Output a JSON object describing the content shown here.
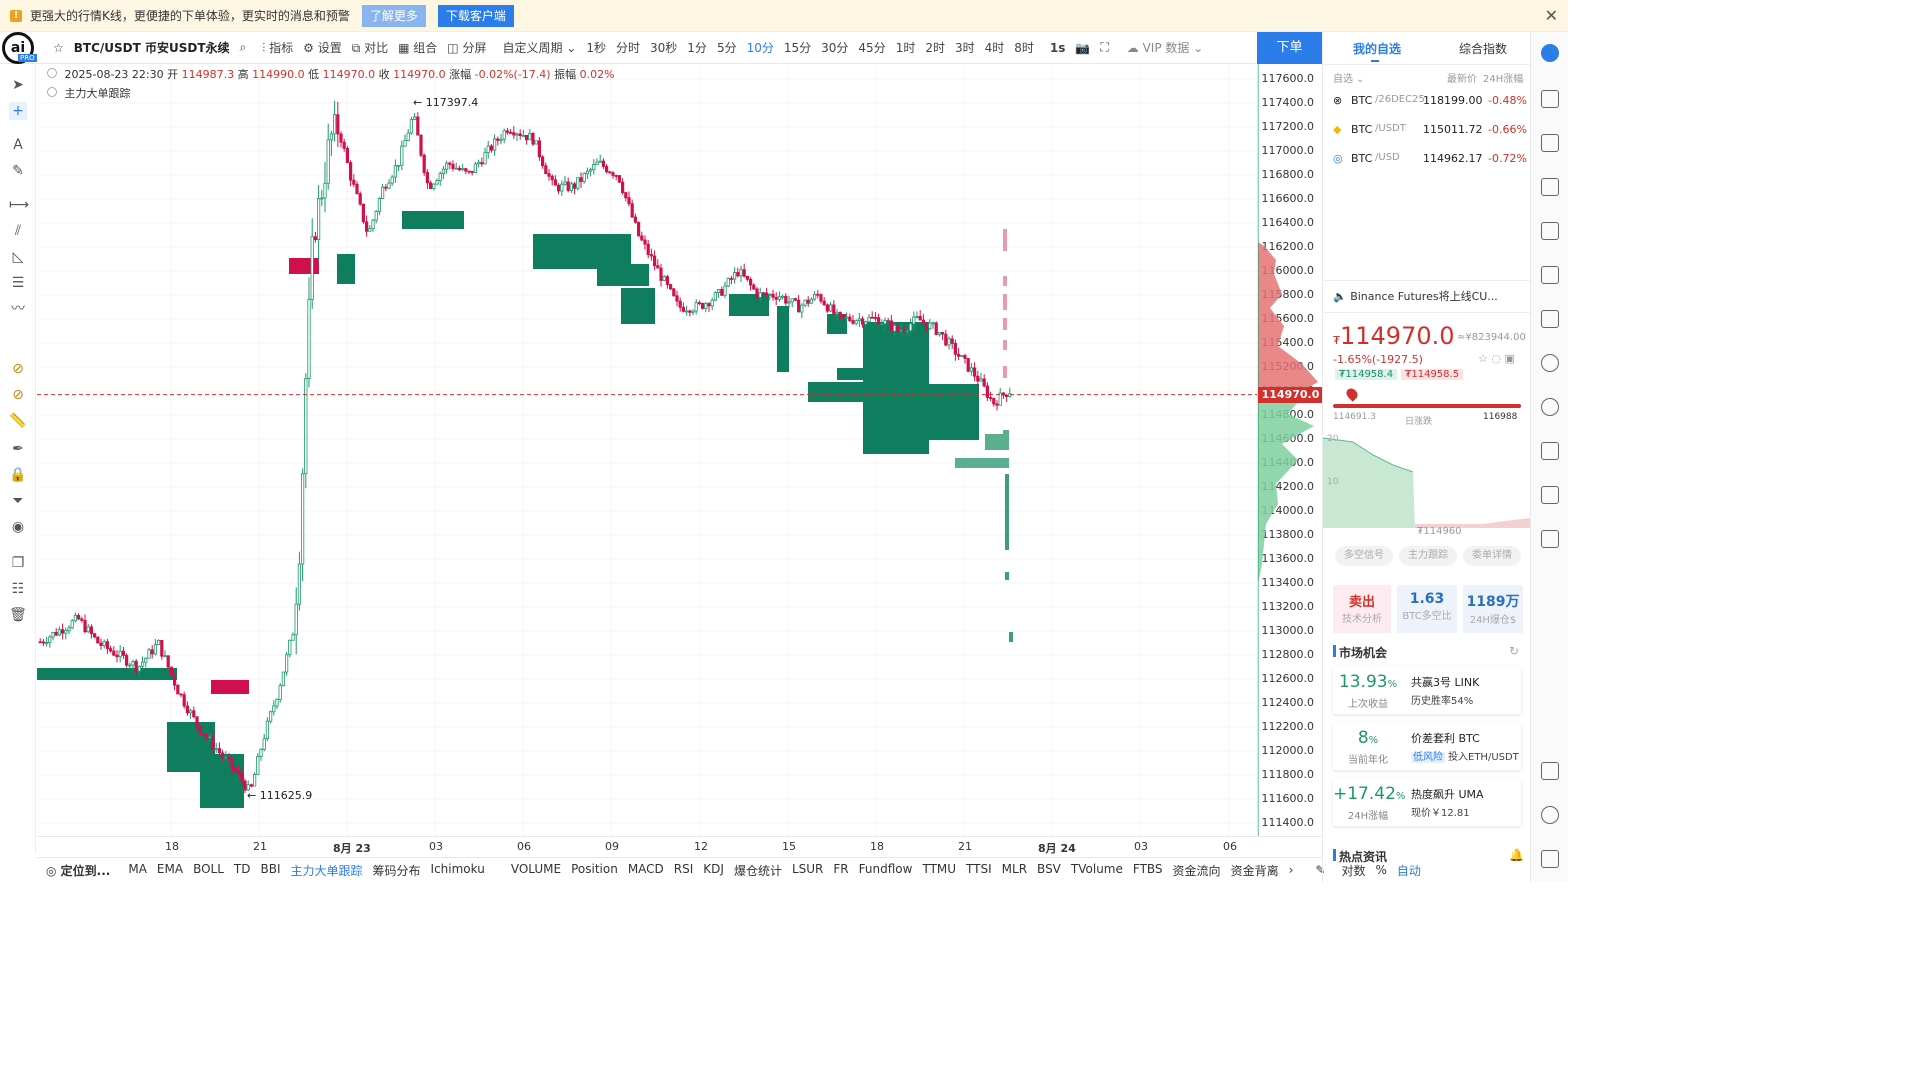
{
  "banner": {
    "message": "更强大的行情K线，更便捷的下单体验，更实时的消息和预警",
    "learn_more": "了解更多",
    "download": "下载客户端",
    "close": "✕",
    "colors": {
      "learn_more_bg": "#8ab4ee",
      "download_bg": "#2b7de9"
    }
  },
  "toolbar": {
    "symbol": "BTC/USDT 币安USDT永续",
    "indicators": "指标",
    "settings": "设置",
    "compare": "对比",
    "combine": "组合",
    "split": "分屏",
    "custom_period": "自定义周期",
    "periods": [
      "1秒",
      "分时",
      "30秒",
      "1分",
      "5分",
      "10分",
      "15分",
      "30分",
      "45分",
      "1时",
      "2时",
      "3时",
      "4时",
      "8时"
    ],
    "active_period": "10分",
    "interval_1s": "1s",
    "vip": "VIP 数据",
    "order": "下单"
  },
  "infobar": {
    "datetime": "2025-08-23 22:30",
    "open_label": "开",
    "open": "114987.3",
    "high_label": "高",
    "high": "114990.0",
    "low_label": "低",
    "low": "114970.0",
    "close_label": "收",
    "close": "114970.0",
    "change_label": "涨幅",
    "change": "-0.02%(-17.4)",
    "amp_label": "振幅",
    "amp": "0.02%",
    "indicator": "主力大单跟踪"
  },
  "chart_data": {
    "type": "candlestick",
    "y_ticks": [
      "117600.0",
      "117400.0",
      "117200.0",
      "117000.0",
      "116800.0",
      "116600.0",
      "116400.0",
      "116200.0",
      "116000.0",
      "115800.0",
      "115600.0",
      "115400.0",
      "115200.0",
      "115000.0",
      "114800.0",
      "114600.0",
      "114400.0",
      "114200.0",
      "114000.0",
      "113800.0",
      "113600.0",
      "113400.0",
      "113200.0",
      "113000.0",
      "112800.0",
      "112600.0",
      "112400.0",
      "112200.0",
      "112000.0",
      "111800.0",
      "111600.0",
      "111400.0"
    ],
    "ylim": [
      111400,
      117700
    ],
    "x_ticks": [
      "18",
      "21",
      "8月 23",
      "03",
      "06",
      "09",
      "12",
      "15",
      "18",
      "21",
      "8月 24",
      "03",
      "06"
    ],
    "current_price": "114970.0",
    "high_annotation": "117397.4",
    "low_annotation": "111625.9",
    "colors": {
      "up": "#d0104c",
      "down": "#0e7e5e",
      "current": "#d0312d"
    }
  },
  "bottombar": {
    "locate": "定位到...",
    "items": [
      "MA",
      "EMA",
      "BOLL",
      "TD",
      "BBI",
      "主力大单跟踪",
      "筹码分布",
      "Ichimoku",
      "VOLUME",
      "Position",
      "MACD",
      "RSI",
      "KDJ",
      "爆仓统计",
      "LSUR",
      "FR",
      "Fundflow",
      "TTMU",
      "TTSI",
      "MLR",
      "BSV",
      "TVolume",
      "FTBS",
      "资金流向",
      "资金背离"
    ],
    "active_item": "主力大单跟踪",
    "log": "对数",
    "percent": "%",
    "auto": "自动"
  },
  "right": {
    "tab_watchlist": "我的自选",
    "tab_index": "综合指数",
    "col_watch": "自选",
    "col_price": "最新价",
    "col_change": "24H涨幅",
    "watchlist": [
      {
        "name": "BTC",
        "sub": "/26DEC25",
        "price": "118199.00",
        "change": "-0.48%"
      },
      {
        "name": "BTC",
        "sub": "/USDT",
        "price": "115011.72",
        "change": "-0.66%"
      },
      {
        "name": "BTC",
        "sub": "/USD",
        "price": "114962.17",
        "change": "-0.72%"
      }
    ],
    "news": "Binance Futures将上线CU...",
    "price": "114970.0",
    "price_cny": "≈¥823944.00",
    "price_change": "-1.65%(-1927.5)",
    "bid": "₮114958.4",
    "ask": "₮114958.5",
    "range_low": "114691.3",
    "range_label": "日涨跌",
    "range_high": "116988",
    "depth_top": "20",
    "depth_mid": "10",
    "depth_price": "₮114960",
    "tags": [
      "多空信号",
      "主力跟踪",
      "委单详情"
    ],
    "signal": {
      "label": "卖出",
      "sub": "技术分析"
    },
    "ratio": {
      "label": "1.63",
      "sub": "BTC多空比"
    },
    "oi": {
      "label": "1189万",
      "sub": "24H爆仓$"
    },
    "market_title": "市场机会",
    "opportunities": [
      {
        "value": "13.93",
        "unit": "%",
        "sub": "上次收益",
        "title": "共赢3号 LINK",
        "desc": "历史胜率54%"
      },
      {
        "value": "8",
        "unit": "%",
        "sub": "当前年化",
        "title": "价差套利 BTC",
        "tag": "低风险",
        "desc": "投入ETH/USDT"
      },
      {
        "value": "+17.42",
        "unit": "%",
        "sub": "24H涨幅",
        "title": "热度飙升 UMA",
        "desc": "现价￥12.81"
      }
    ],
    "hot_title": "热点资讯"
  }
}
